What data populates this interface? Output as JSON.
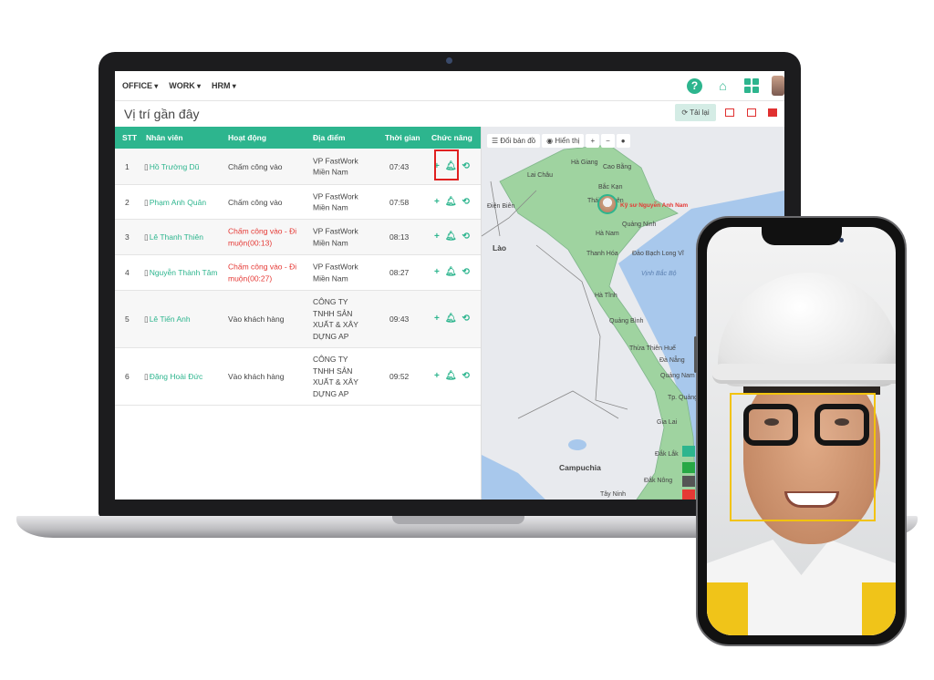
{
  "nav": {
    "menus": [
      "OFFICE",
      "WORK",
      "HRM"
    ],
    "icons": [
      "help-icon",
      "home-icon",
      "apps-grid-icon",
      "user-avatar"
    ]
  },
  "page": {
    "title": "Vị trí gần đây",
    "reload_label": "Tải lại",
    "reload_icon": "refresh-icon",
    "view_icons": [
      "map-view-icon",
      "split-view-icon",
      "table-view-icon"
    ]
  },
  "table": {
    "headers": [
      "STT",
      "Nhân viên",
      "Hoạt động",
      "Địa điểm",
      "Thời gian",
      "Chức năng"
    ],
    "rows": [
      {
        "stt": "1",
        "name": "Hồ Trường Dũ",
        "activity": "Chấm công vào",
        "late": false,
        "place": "VP FastWork Miền Nam",
        "time": "07:43"
      },
      {
        "stt": "2",
        "name": "Phạm Anh Quân",
        "activity": "Chấm công vào",
        "late": false,
        "place": "VP FastWork Miền Nam",
        "time": "07:58"
      },
      {
        "stt": "3",
        "name": "Lê Thanh Thiên",
        "activity": "Chấm công vào - Đi muộn(00:13)",
        "late": true,
        "place": "VP FastWork Miền Nam",
        "time": "08:13"
      },
      {
        "stt": "4",
        "name": "Nguyễn Thành Tâm",
        "activity": "Chấm công vào - Đi muộn(00:27)",
        "late": true,
        "place": "VP FastWork Miền Nam",
        "time": "08:27"
      },
      {
        "stt": "5",
        "name": "Lê Tiến Anh",
        "activity": "Vào khách hàng",
        "late": false,
        "place": "CÔNG TY TNHH SẢN XUẤT & XÂY DỰNG AP",
        "time": "09:43"
      },
      {
        "stt": "6",
        "name": "Đặng Hoài Đức",
        "activity": "Vào khách hàng",
        "late": false,
        "place": "CÔNG TY TNHH SẢN XUẤT & XÂY DỰNG AP",
        "time": "09:52"
      }
    ],
    "action_icons": [
      "plus-icon",
      "bell-icon",
      "history-icon"
    ]
  },
  "map": {
    "toolbar": {
      "change_map": "Đổi bản đồ",
      "display": "Hiển thị"
    },
    "marker_name": "Kỹ sư Nguyễn Anh Nam",
    "labels": [
      "Hà Giang",
      "Cao Bằng",
      "Lai Châu",
      "Bắc Kạn",
      "Thái Nguyên",
      "Điện Biên",
      "Quảng Ninh",
      "Hà Nam",
      "Lào",
      "Thanh Hóa",
      "Đảo Bạch Long Vĩ",
      "Vịnh Bắc Bộ",
      "Hà Tĩnh",
      "Quảng Bình",
      "Thừa Thiên Huế",
      "Đà Nẵng",
      "Quảng Nam",
      "Tp. Quảng Ngãi",
      "Gia Lai",
      "Đắk Lắk",
      "Campuchia",
      "Đắk Nông",
      "Tây Ninh"
    ],
    "colors": {
      "land": "#9fd3a0",
      "sea": "#a8c8ec",
      "bg": "#e8eaee"
    }
  },
  "colors": {
    "accent": "#2db58e",
    "late": "#e53935",
    "face_box": "#f2c30d"
  }
}
